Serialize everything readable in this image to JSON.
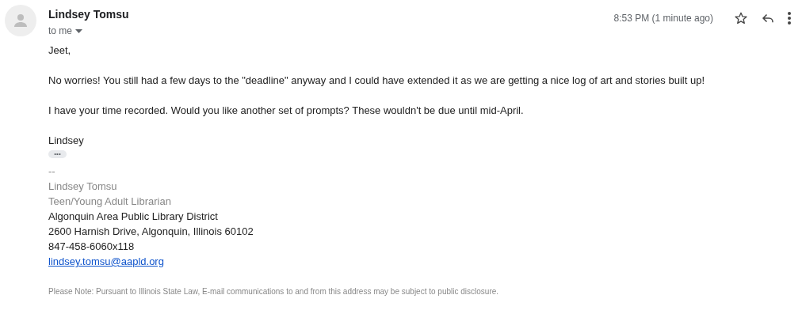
{
  "sender": {
    "name": "Lindsey Tomsu",
    "recipient": "to me"
  },
  "timestamp": "8:53 PM (1 minute ago)",
  "starred": false,
  "body": [
    "Jeet,",
    "No worries! You still had a few days to the \"deadline\" anyway and I could have extended it as we are getting a nice log of art and stories built up!",
    "I have your time recorded. Would you like another set of prompts? These wouldn't be due until mid-April.",
    "Lindsey"
  ],
  "trimmed_content_button": "•••",
  "signature": [
    {
      "kind": "dim",
      "text": "--"
    },
    {
      "kind": "dim",
      "text": "Lindsey Tomsu"
    },
    {
      "kind": "dim",
      "text": "Teen/Young Adult Librarian"
    },
    {
      "kind": "plain",
      "text": "Algonquin Area Public Library District"
    },
    {
      "kind": "plain",
      "text": "2600 Harnish Drive, Algonquin, Illinois 60102"
    },
    {
      "kind": "plain",
      "text": "847-458-6060x118"
    },
    {
      "kind": "link",
      "text": "lindsey.tomsu@aapld.org"
    }
  ],
  "disclaimer": "Please Note: Pursuant to Illinois State Law, E-mail communications to and from this address may be subject to public disclosure."
}
